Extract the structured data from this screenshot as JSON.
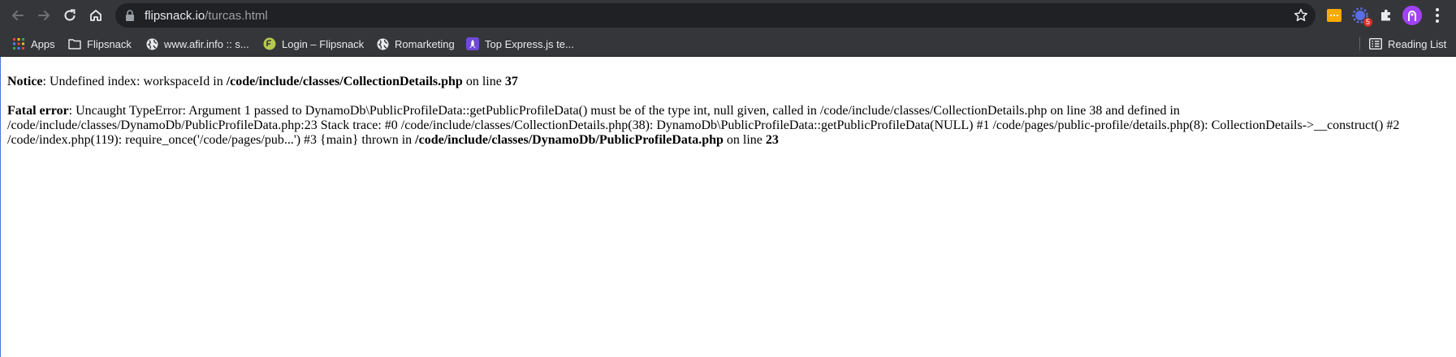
{
  "browser": {
    "url_host": "flipsnack.io",
    "url_path": "/turcas.html",
    "extensions": [
      {
        "name": "yellow-extension-icon",
        "color": "#f9ab00"
      },
      {
        "name": "puzzle-gear-extension-icon",
        "badge": "5"
      },
      {
        "name": "extensions-puzzle-icon"
      }
    ]
  },
  "bookmarks": {
    "items": [
      {
        "label": "Apps",
        "icon": "apps-grid-icon"
      },
      {
        "label": "Flipsnack",
        "icon": "folder-icon"
      },
      {
        "label": "www.afir.info :: s...",
        "icon": "globe-icon"
      },
      {
        "label": "Login – Flipsnack",
        "icon": "flipsnack-logo-icon"
      },
      {
        "label": "Romarketing",
        "icon": "globe-icon"
      },
      {
        "label": "Top Express.js te...",
        "icon": "rocket-icon"
      }
    ],
    "reading_list": "Reading List"
  },
  "page": {
    "notice": {
      "label": "Notice",
      "text1": ": Undefined index: workspaceId in ",
      "file": "/code/include/classes/CollectionDetails.php",
      "text2": " on line ",
      "line": "37"
    },
    "fatal": {
      "label": "Fatal error",
      "text1": ": Uncaught TypeError: Argument 1 passed to DynamoDb\\PublicProfileData::getPublicProfileData() must be of the type int, null given, called in /code/include/classes/CollectionDetails.php on line 38 and defined in /code/include/classes/DynamoDb/PublicProfileData.php:23 Stack trace: #0 /code/include/classes/CollectionDetails.php(38): DynamoDb\\PublicProfileData::getPublicProfileData(NULL) #1 /code/pages/public-profile/details.php(8): CollectionDetails->__construct() #2 /code/index.php(119): require_once('/code/pages/pub...') #3 {main} thrown in ",
      "file": "/code/include/classes/DynamoDb/PublicProfileData.php",
      "text2": " on line ",
      "line": "23"
    }
  }
}
